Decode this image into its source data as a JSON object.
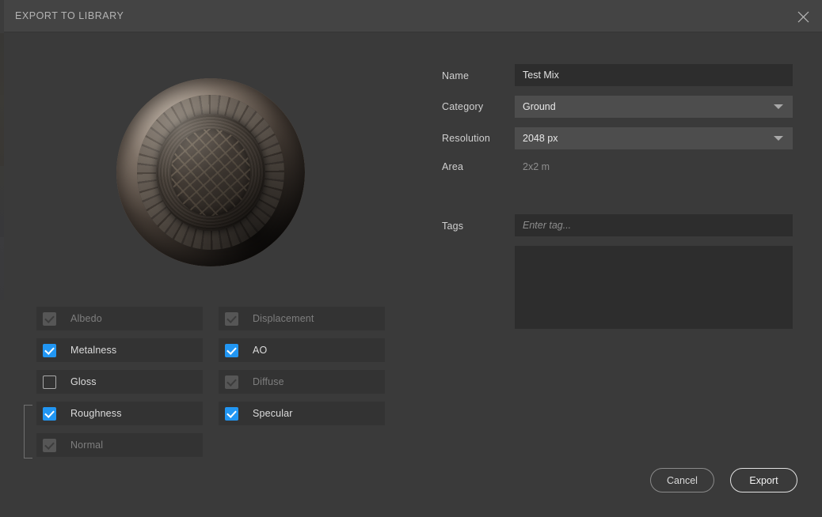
{
  "dialog": {
    "title": "EXPORT TO LIBRARY",
    "close_icon": "close-icon"
  },
  "preview": {
    "shape": "sphere",
    "material": "manhole-cover-cobblestone"
  },
  "maps": {
    "columns": [
      {
        "items": [
          {
            "label": "Albedo",
            "state": "locked"
          },
          {
            "label": "Metalness",
            "state": "checked"
          },
          {
            "label": "Gloss",
            "state": "unchecked"
          },
          {
            "label": "Roughness",
            "state": "checked"
          },
          {
            "label": "Normal",
            "state": "locked"
          }
        ]
      },
      {
        "items": [
          {
            "label": "Displacement",
            "state": "locked"
          },
          {
            "label": "AO",
            "state": "checked"
          },
          {
            "label": "Diffuse",
            "state": "locked"
          },
          {
            "label": "Specular",
            "state": "checked"
          }
        ]
      }
    ]
  },
  "form": {
    "name": {
      "label": "Name",
      "value": "Test Mix",
      "placeholder": ""
    },
    "category": {
      "label": "Category",
      "value": "Ground",
      "options": [
        "Ground"
      ]
    },
    "resolution": {
      "label": "Resolution",
      "value": "2048 px",
      "options": [
        "2048 px"
      ]
    },
    "area": {
      "label": "Area",
      "value": "2x2 m"
    },
    "tags": {
      "label": "Tags",
      "value": "",
      "placeholder": "Enter tag...",
      "entries": []
    }
  },
  "footer": {
    "cancel_label": "Cancel",
    "export_label": "Export"
  },
  "colors": {
    "accent_blue": "#2196f3",
    "background": "#3a3a3a",
    "title_bar": "#444444",
    "input_bg": "#2d2d2d",
    "dropdown_bg": "#4d4d4d",
    "row_bg": "#333333"
  }
}
